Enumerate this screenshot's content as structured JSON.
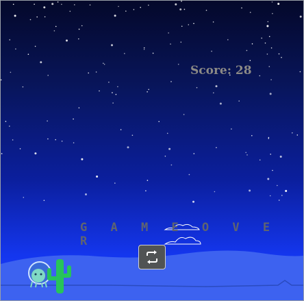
{
  "game": {
    "score_text": "Score: 28",
    "game_over_text": "G A M E  O V E R"
  },
  "controls": {
    "restart_icon": "restart-icon"
  },
  "colors": {
    "score": "#8c8a86",
    "game_over": "#5f6470",
    "dune": "#3d62f0",
    "cactus": "#27c45a",
    "player": "#7fd9c4",
    "cloud_outline": "#ffffff"
  }
}
